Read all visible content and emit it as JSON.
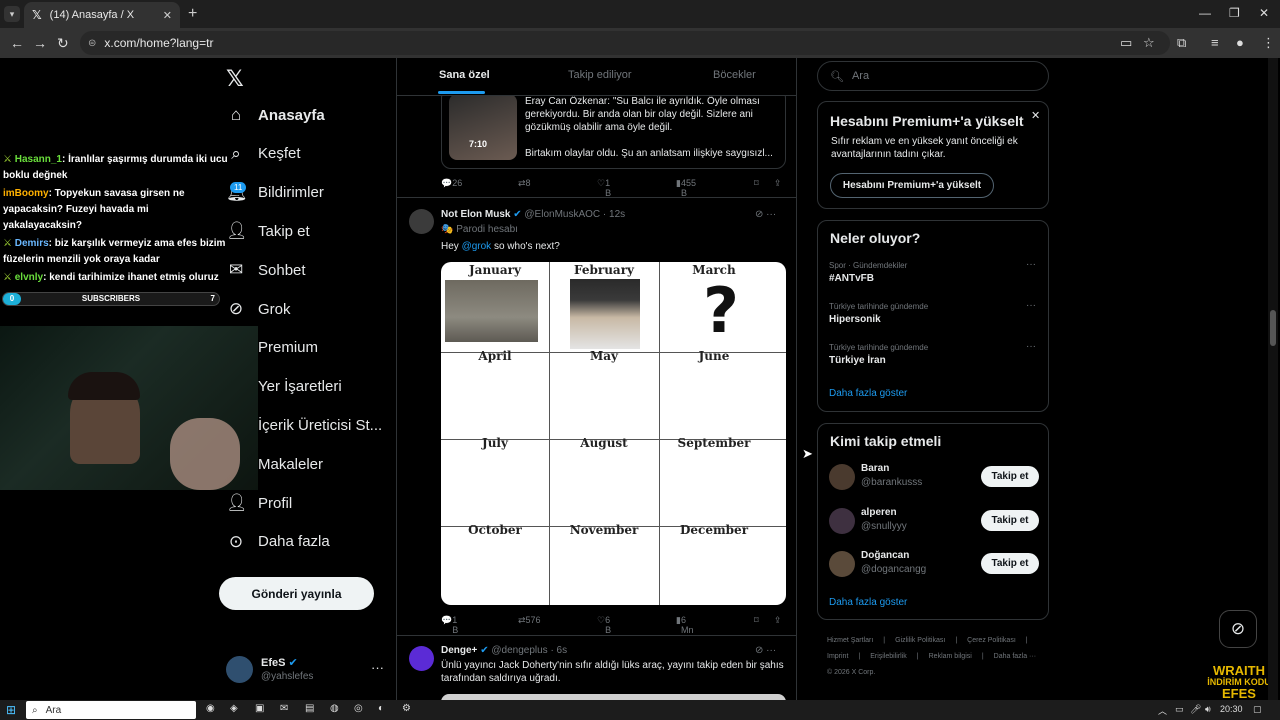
{
  "browser": {
    "tab_title": "(14) Anasayfa / X",
    "url": "x.com/home?lang=tr"
  },
  "sidebar": {
    "items": [
      {
        "label": "Anasayfa",
        "icon": "home-icon"
      },
      {
        "label": "Keşfet",
        "icon": "search-icon"
      },
      {
        "label": "Bildirimler",
        "icon": "bell-icon"
      },
      {
        "label": "Takip et",
        "icon": "person-add-icon"
      },
      {
        "label": "Sohbet",
        "icon": "mail-icon"
      },
      {
        "label": "Grok",
        "icon": "grok-icon"
      },
      {
        "label": "Premium",
        "icon": "x-icon"
      },
      {
        "label": "Yer İşaretleri",
        "icon": "bookmark-icon"
      },
      {
        "label": "İçerik Üreticisi St...",
        "icon": "studio-icon"
      },
      {
        "label": "Makaleler",
        "icon": "article-icon"
      },
      {
        "label": "Profil",
        "icon": "person-icon"
      },
      {
        "label": "Daha fazla",
        "icon": "more-circle-icon"
      }
    ],
    "notification_badge": "11",
    "post_button": "Gönderi yayınla",
    "account": {
      "name": "EfeS",
      "handle": "@yahslefes"
    }
  },
  "stream_overlay": {
    "chat": [
      {
        "user": "Hasann_1",
        "text": ": İranlılar şaşırmış durumda iki ucu boklu değnek",
        "color": "#6adf3c",
        "icon": "sword-icon"
      },
      {
        "user": "imBoomy",
        "text": ": Topyekun savasa girsen ne yapacaksin? Fuzeyi havada mi yakalayacaksin?",
        "color": "#ffb100",
        "icon": ""
      },
      {
        "user": "Demirs",
        "text": ": biz karşılık vermeyiz ama efes bizim füzelerin menzili yok oraya kadar",
        "color": "#6ab8ff",
        "icon": "sword-icon"
      },
      {
        "user": "elvnly",
        "text": ": kendi tarihimize ihanet etmiş oluruz",
        "color": "#6adf3c",
        "icon": "sword-icon"
      }
    ],
    "subscribers_label": "SUBSCRIBERS",
    "subscribers_left": "0",
    "subscribers_right": "7",
    "watermark_line1": "WRAITH",
    "watermark_line2": "İNDİRİM KODU",
    "watermark_line3": "EFES"
  },
  "feed": {
    "tabs": [
      "Sana özel",
      "Takip ediliyor",
      "Böcekler"
    ],
    "quote_card": {
      "duration": "7:10",
      "text": "Eray Can Özkenar: \"Su Balcı ile ayrıldık. Öyle olması gerekiyordu. Bir anda olan bir olay değil. Sizlere ani gözükmüş olabilir ama öyle değil.",
      "text2": "Birtakım olaylar oldu. Şu an anlatsam ilişkiye saygısızl..."
    },
    "post1_actions": {
      "replies": "26",
      "reposts": "8",
      "likes": "1 B",
      "views": "455 B"
    },
    "post2": {
      "name": "Not Elon Musk",
      "handle": "@ElonMuskAOC",
      "time": "· 12s",
      "parody": "Parodi hesabı",
      "text_prefix": "Hey ",
      "mention": "@grok",
      "text_suffix": " so who's next?",
      "months": [
        "January",
        "February",
        "March",
        "April",
        "May",
        "June",
        "July",
        "August",
        "September",
        "October",
        "November",
        "December"
      ],
      "actions": {
        "replies": "1 B",
        "reposts": "576",
        "likes": "6 B",
        "views": "6 Mn"
      }
    },
    "post3": {
      "name": "Denge+",
      "handle": "@dengeplus",
      "time": "· 6s",
      "text": "Ünlü yayıncı Jack Doherty'nin sıfır aldığı lüks araç, yayını takip eden bir şahıs tarafından saldırıya uğradı."
    }
  },
  "right": {
    "search_placeholder": "Ara",
    "premium": {
      "title": "Hesabını Premium+'a yükselt",
      "desc": "Sıfır reklam ve en yüksek yanıt önceliği ek avantajlarının tadını çıkar.",
      "button": "Hesabını Premium+'a yükselt"
    },
    "trends_title": "Neler oluyor?",
    "trends": [
      {
        "category": "Spor · Gündemdekiler",
        "name": "#ANTvFB"
      },
      {
        "category": "Türkiye tarihinde gündemde",
        "name": "Hipersonik"
      },
      {
        "category": "Türkiye tarihinde gündemde",
        "name": "Türkiye İran"
      }
    ],
    "trends_more": "Daha fazla göster",
    "wtf_title": "Kimi takip etmeli",
    "who_to_follow": [
      {
        "name": "Baran",
        "handle": "@barankusss"
      },
      {
        "name": "alperen",
        "handle": "@snullyyy"
      },
      {
        "name": "Doğancan",
        "handle": "@dogancangg"
      }
    ],
    "follow_label": "Takip et",
    "wtf_more": "Daha fazla göster",
    "footer": [
      "Hizmet Şartları",
      "|",
      "Gizlilik Politikası",
      "|",
      "Çerez Politikası",
      "|",
      "Imprint",
      "|",
      "Erişilebilirlik",
      "|",
      "Reklam bilgisi",
      "|",
      "Daha fazla ···",
      "© 2026 X Corp."
    ]
  },
  "taskbar": {
    "search_label": "Ara",
    "clock": "20:30"
  },
  "colors": {
    "accent": "#1d9bf0",
    "background": "#000000",
    "border": "#2f3336",
    "muted": "#71767b"
  }
}
